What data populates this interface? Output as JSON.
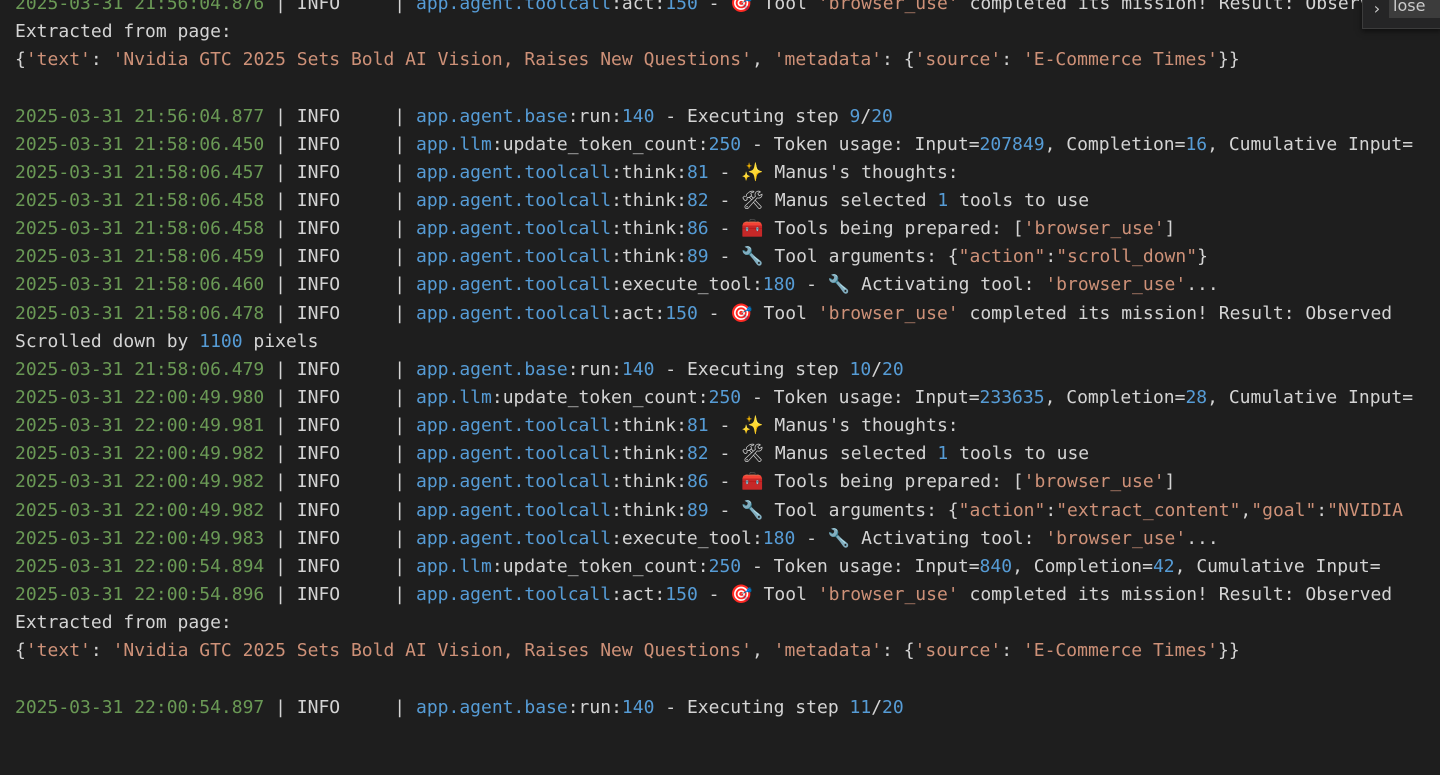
{
  "find_widget": {
    "toggle_icon": "chevron-right-icon",
    "toggle_glyph": "›",
    "label": "lose"
  },
  "lines": [
    {
      "kind": "log",
      "ts": "2025-03-31 21:56:04.876",
      "level": "INFO",
      "module": "app.agent.toolcall",
      "func": "act",
      "lineno": "150",
      "icon": "🎯",
      "msg": [
        {
          "t": "s",
          "v": " Tool "
        },
        {
          "t": "str",
          "v": "'browser_use'"
        },
        {
          "t": "s",
          "v": " completed its mission! Result: Observed output of cmd `browser_use` executed:"
        }
      ]
    },
    {
      "kind": "text",
      "msg": [
        {
          "t": "s",
          "v": "Extracted from page:"
        }
      ]
    },
    {
      "kind": "text",
      "msg": [
        {
          "t": "s",
          "v": "{"
        },
        {
          "t": "str",
          "v": "'text'"
        },
        {
          "t": "s",
          "v": ": "
        },
        {
          "t": "str",
          "v": "'Nvidia GTC 2025 Sets Bold AI Vision, Raises New Questions'"
        },
        {
          "t": "s",
          "v": ", "
        },
        {
          "t": "str",
          "v": "'metadata'"
        },
        {
          "t": "s",
          "v": ": {"
        },
        {
          "t": "str",
          "v": "'source'"
        },
        {
          "t": "s",
          "v": ": "
        },
        {
          "t": "str",
          "v": "'E-Commerce Times'"
        },
        {
          "t": "s",
          "v": "}}"
        }
      ]
    },
    {
      "kind": "blank"
    },
    {
      "kind": "log",
      "ts": "2025-03-31 21:56:04.877",
      "level": "INFO",
      "module": "app.agent.base",
      "func": "run",
      "lineno": "140",
      "msg": [
        {
          "t": "s",
          "v": "Executing step "
        },
        {
          "t": "num",
          "v": "9"
        },
        {
          "t": "s",
          "v": "/"
        },
        {
          "t": "num",
          "v": "20"
        }
      ]
    },
    {
      "kind": "log",
      "ts": "2025-03-31 21:58:06.450",
      "level": "INFO",
      "module": "app.llm",
      "func": "update_token_count",
      "lineno": "250",
      "msg": [
        {
          "t": "s",
          "v": "Token usage: Input="
        },
        {
          "t": "num",
          "v": "207849"
        },
        {
          "t": "s",
          "v": ", Completion="
        },
        {
          "t": "num",
          "v": "16"
        },
        {
          "t": "s",
          "v": ", Cumulative Input="
        }
      ]
    },
    {
      "kind": "log",
      "ts": "2025-03-31 21:58:06.457",
      "level": "INFO",
      "module": "app.agent.toolcall",
      "func": "think",
      "lineno": "81",
      "icon": "✨",
      "msg": [
        {
          "t": "s",
          "v": " Manus's thoughts:"
        }
      ]
    },
    {
      "kind": "log",
      "ts": "2025-03-31 21:58:06.458",
      "level": "INFO",
      "module": "app.agent.toolcall",
      "func": "think",
      "lineno": "82",
      "icon": "🛠",
      "msg": [
        {
          "t": "s",
          "v": " Manus selected "
        },
        {
          "t": "num",
          "v": "1"
        },
        {
          "t": "s",
          "v": " tools to use"
        }
      ]
    },
    {
      "kind": "log",
      "ts": "2025-03-31 21:58:06.458",
      "level": "INFO",
      "module": "app.agent.toolcall",
      "func": "think",
      "lineno": "86",
      "icon": "🧰",
      "msg": [
        {
          "t": "s",
          "v": " Tools being prepared: ["
        },
        {
          "t": "str",
          "v": "'browser_use'"
        },
        {
          "t": "s",
          "v": "]"
        }
      ]
    },
    {
      "kind": "log",
      "ts": "2025-03-31 21:58:06.459",
      "level": "INFO",
      "module": "app.agent.toolcall",
      "func": "think",
      "lineno": "89",
      "icon": "🔧",
      "msg": [
        {
          "t": "s",
          "v": " Tool arguments: {"
        },
        {
          "t": "str",
          "v": "\"action\""
        },
        {
          "t": "s",
          "v": ":"
        },
        {
          "t": "str",
          "v": "\"scroll_down\""
        },
        {
          "t": "s",
          "v": "}"
        }
      ]
    },
    {
      "kind": "log",
      "ts": "2025-03-31 21:58:06.460",
      "level": "INFO",
      "module": "app.agent.toolcall",
      "func": "execute_tool",
      "lineno": "180",
      "icon": "🔧",
      "msg": [
        {
          "t": "s",
          "v": " Activating tool: "
        },
        {
          "t": "str",
          "v": "'browser_use'"
        },
        {
          "t": "s",
          "v": "..."
        }
      ]
    },
    {
      "kind": "log",
      "ts": "2025-03-31 21:58:06.478",
      "level": "INFO",
      "module": "app.agent.toolcall",
      "func": "act",
      "lineno": "150",
      "icon": "🎯",
      "msg": [
        {
          "t": "s",
          "v": " Tool "
        },
        {
          "t": "str",
          "v": "'browser_use'"
        },
        {
          "t": "s",
          "v": " completed its mission! Result: Observed"
        }
      ]
    },
    {
      "kind": "text",
      "msg": [
        {
          "t": "s",
          "v": "Scrolled down by "
        },
        {
          "t": "num",
          "v": "1100"
        },
        {
          "t": "s",
          "v": " pixels"
        }
      ]
    },
    {
      "kind": "log",
      "ts": "2025-03-31 21:58:06.479",
      "level": "INFO",
      "module": "app.agent.base",
      "func": "run",
      "lineno": "140",
      "msg": [
        {
          "t": "s",
          "v": "Executing step "
        },
        {
          "t": "num",
          "v": "10"
        },
        {
          "t": "s",
          "v": "/"
        },
        {
          "t": "num",
          "v": "20"
        }
      ]
    },
    {
      "kind": "log",
      "ts": "2025-03-31 22:00:49.980",
      "level": "INFO",
      "module": "app.llm",
      "func": "update_token_count",
      "lineno": "250",
      "msg": [
        {
          "t": "s",
          "v": "Token usage: Input="
        },
        {
          "t": "num",
          "v": "233635"
        },
        {
          "t": "s",
          "v": ", Completion="
        },
        {
          "t": "num",
          "v": "28"
        },
        {
          "t": "s",
          "v": ", Cumulative Input="
        }
      ]
    },
    {
      "kind": "log",
      "ts": "2025-03-31 22:00:49.981",
      "level": "INFO",
      "module": "app.agent.toolcall",
      "func": "think",
      "lineno": "81",
      "icon": "✨",
      "msg": [
        {
          "t": "s",
          "v": " Manus's thoughts:"
        }
      ]
    },
    {
      "kind": "log",
      "ts": "2025-03-31 22:00:49.982",
      "level": "INFO",
      "module": "app.agent.toolcall",
      "func": "think",
      "lineno": "82",
      "icon": "🛠",
      "msg": [
        {
          "t": "s",
          "v": " Manus selected "
        },
        {
          "t": "num",
          "v": "1"
        },
        {
          "t": "s",
          "v": " tools to use"
        }
      ]
    },
    {
      "kind": "log",
      "ts": "2025-03-31 22:00:49.982",
      "level": "INFO",
      "module": "app.agent.toolcall",
      "func": "think",
      "lineno": "86",
      "icon": "🧰",
      "msg": [
        {
          "t": "s",
          "v": " Tools being prepared: ["
        },
        {
          "t": "str",
          "v": "'browser_use'"
        },
        {
          "t": "s",
          "v": "]"
        }
      ]
    },
    {
      "kind": "log",
      "ts": "2025-03-31 22:00:49.982",
      "level": "INFO",
      "module": "app.agent.toolcall",
      "func": "think",
      "lineno": "89",
      "icon": "🔧",
      "msg": [
        {
          "t": "s",
          "v": " Tool arguments: {"
        },
        {
          "t": "str",
          "v": "\"action\""
        },
        {
          "t": "s",
          "v": ":"
        },
        {
          "t": "str",
          "v": "\"extract_content\""
        },
        {
          "t": "s",
          "v": ","
        },
        {
          "t": "str",
          "v": "\"goal\""
        },
        {
          "t": "s",
          "v": ":"
        },
        {
          "t": "str",
          "v": "\"NVIDIA"
        }
      ]
    },
    {
      "kind": "log",
      "ts": "2025-03-31 22:00:49.983",
      "level": "INFO",
      "module": "app.agent.toolcall",
      "func": "execute_tool",
      "lineno": "180",
      "icon": "🔧",
      "msg": [
        {
          "t": "s",
          "v": " Activating tool: "
        },
        {
          "t": "str",
          "v": "'browser_use'"
        },
        {
          "t": "s",
          "v": "..."
        }
      ]
    },
    {
      "kind": "log",
      "ts": "2025-03-31 22:00:54.894",
      "level": "INFO",
      "module": "app.llm",
      "func": "update_token_count",
      "lineno": "250",
      "msg": [
        {
          "t": "s",
          "v": "Token usage: Input="
        },
        {
          "t": "num",
          "v": "840"
        },
        {
          "t": "s",
          "v": ", Completion="
        },
        {
          "t": "num",
          "v": "42"
        },
        {
          "t": "s",
          "v": ", Cumulative Input="
        }
      ]
    },
    {
      "kind": "log",
      "ts": "2025-03-31 22:00:54.896",
      "level": "INFO",
      "module": "app.agent.toolcall",
      "func": "act",
      "lineno": "150",
      "icon": "🎯",
      "msg": [
        {
          "t": "s",
          "v": " Tool "
        },
        {
          "t": "str",
          "v": "'browser_use'"
        },
        {
          "t": "s",
          "v": " completed its mission! Result: Observed"
        }
      ]
    },
    {
      "kind": "text",
      "msg": [
        {
          "t": "s",
          "v": "Extracted from page:"
        }
      ]
    },
    {
      "kind": "text",
      "msg": [
        {
          "t": "s",
          "v": "{"
        },
        {
          "t": "str",
          "v": "'text'"
        },
        {
          "t": "s",
          "v": ": "
        },
        {
          "t": "str",
          "v": "'Nvidia GTC 2025 Sets Bold AI Vision, Raises New Questions'"
        },
        {
          "t": "s",
          "v": ", "
        },
        {
          "t": "str",
          "v": "'metadata'"
        },
        {
          "t": "s",
          "v": ": {"
        },
        {
          "t": "str",
          "v": "'source'"
        },
        {
          "t": "s",
          "v": ": "
        },
        {
          "t": "str",
          "v": "'E-Commerce Times'"
        },
        {
          "t": "s",
          "v": "}}"
        }
      ]
    },
    {
      "kind": "blank"
    },
    {
      "kind": "log",
      "ts": "2025-03-31 22:00:54.897",
      "level": "INFO",
      "module": "app.agent.base",
      "func": "run",
      "lineno": "140",
      "msg": [
        {
          "t": "s",
          "v": "Executing step "
        },
        {
          "t": "num",
          "v": "11"
        },
        {
          "t": "s",
          "v": "/"
        },
        {
          "t": "num",
          "v": "20"
        }
      ]
    }
  ]
}
